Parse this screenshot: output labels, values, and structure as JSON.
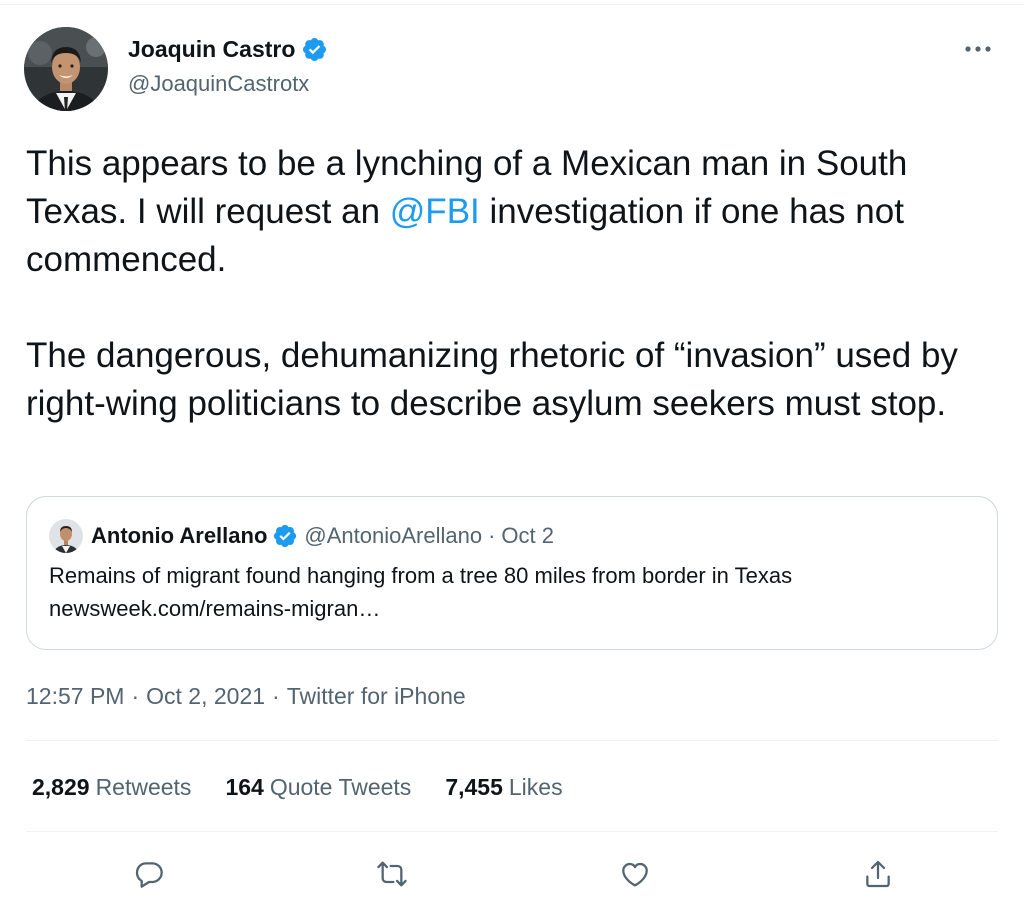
{
  "tweet": {
    "author": {
      "name": "Joaquin Castro",
      "handle": "@JoaquinCastrotx",
      "verified": true,
      "avatar_icon": "user-avatar"
    },
    "menu_icon": "more-horizontal-icon",
    "text": {
      "para1_before": "This appears to be a lynching of a Mexican man in South Texas. I will request an ",
      "mention": "@FBI",
      "para1_after": " investigation if one has not commenced.",
      "para2": "The dangerous, dehumanizing rhetoric of “invasion” used by right-wing politicians to describe asylum seekers must stop."
    },
    "quote": {
      "name": "Antonio Arellano",
      "handle": "@AntonioArellano",
      "separator": "·",
      "date": "Oct 2",
      "verified": true,
      "text_line1": "Remains of migrant found hanging from a tree 80 miles from border in Texas",
      "text_line2": "newsweek.com/remains-migran…"
    },
    "meta": {
      "time": "12:57 PM",
      "separator": "·",
      "date": "Oct 2, 2021",
      "source": "Twitter for iPhone"
    },
    "stats": {
      "retweets_count": "2,829",
      "retweets_label": "Retweets",
      "quotes_count": "164",
      "quotes_label": "Quote Tweets",
      "likes_count": "7,455",
      "likes_label": "Likes"
    },
    "actions": [
      "reply-icon",
      "retweet-icon",
      "like-icon",
      "share-icon"
    ],
    "colors": {
      "link": "#1d9bf0",
      "secondary_text": "#536471",
      "primary_text": "#0f1419",
      "verified_badge": "#1d9bf0",
      "border": "#cfd9de"
    }
  }
}
